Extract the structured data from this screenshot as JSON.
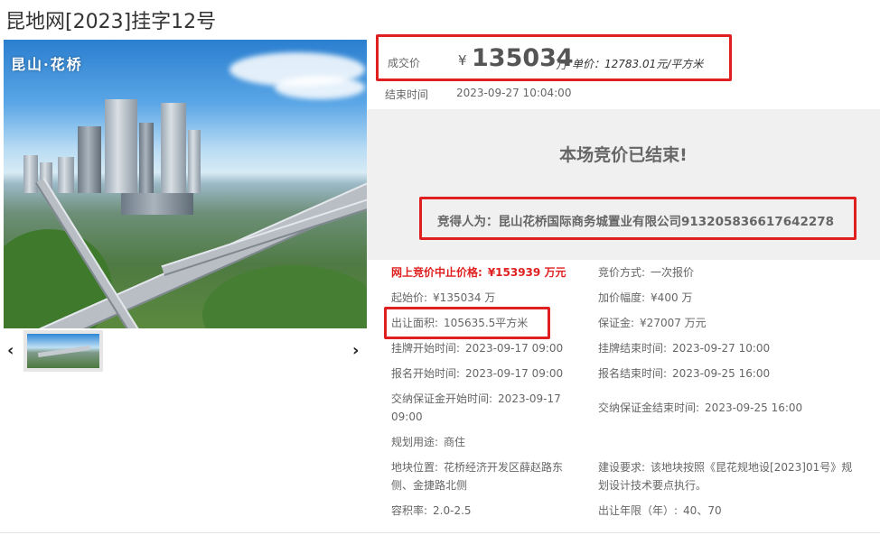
{
  "page": {
    "title": "昆地网[2023]挂字12号"
  },
  "gallery": {
    "caption": "昆山·花桥",
    "prev_label": "‹",
    "next_label": "›"
  },
  "deal": {
    "label": "成交价",
    "currency": "¥",
    "price": "135034",
    "unit": "万",
    "unit_price": "单价：12783.01元/平方米"
  },
  "end_time": {
    "label": "结束时间",
    "value": "2023-09-27 10:04:00"
  },
  "status": {
    "message": "本场竞价已结束!",
    "winner": "竞得人为：昆山花桥国际商务城置业有限公司913205836617642278"
  },
  "details": {
    "cap_price": {
      "label": "网上竞价中止价格:",
      "value": "¥153939 万元"
    },
    "bid_method": {
      "label": "竞价方式:",
      "value": "一次报价"
    },
    "start_price": {
      "label": "起始价:",
      "value": "¥135034 万"
    },
    "increment": {
      "label": "加价幅度:",
      "value": "¥400 万"
    },
    "area": {
      "label": "出让面积:",
      "value": "105635.5平方米"
    },
    "deposit": {
      "label": "保证金:",
      "value": "¥27007 万元"
    },
    "listing_start": {
      "label": "挂牌开始时间:",
      "value": "2023-09-17 09:00"
    },
    "listing_end": {
      "label": "挂牌结束时间:",
      "value": "2023-09-27 10:00"
    },
    "signup_start": {
      "label": "报名开始时间:",
      "value": "2023-09-17 09:00"
    },
    "signup_end": {
      "label": "报名结束时间:",
      "value": "2023-09-25 16:00"
    },
    "deposit_start": {
      "label": "交纳保证金开始时间:",
      "value_line1": "2023-09-17",
      "value_line2": "09:00"
    },
    "deposit_end": {
      "label": "交纳保证金结束时间:",
      "value": "2023-09-25 16:00"
    },
    "usage": {
      "label": "规划用途:",
      "value": "商住"
    },
    "location": {
      "label": "地块位置:",
      "value_line1": "花桥经济开发区薛赵路东",
      "value_line2": "侧、金捷路北侧"
    },
    "requirement": {
      "label": "建设要求:",
      "value_line1": "该地块按照《昆花规地设[2023]01号》规",
      "value_line2": "划设计技术要点执行。"
    },
    "plot_ratio": {
      "label": "容积率:",
      "value": "2.0-2.5"
    },
    "term": {
      "label": "出让年限（年）:",
      "value": "40、70"
    }
  },
  "colors": {
    "highlight": "#e02020",
    "panel": "#f0f0f0",
    "text": "#666666"
  }
}
